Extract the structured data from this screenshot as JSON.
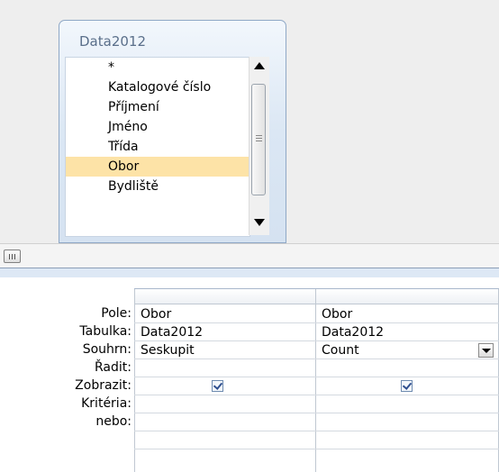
{
  "table": {
    "title": "Data2012",
    "fields": [
      "*",
      "Katalogové číslo",
      "Příjmení",
      "Jméno",
      "Třída",
      "Obor",
      "Bydliště"
    ],
    "selected_field": "Obor"
  },
  "grid": {
    "row_labels": {
      "field": "Pole:",
      "table": "Tabulka:",
      "total": "Souhrn:",
      "sort": "Řadit:",
      "show": "Zobrazit:",
      "criteria": "Kritéria:",
      "or": "nebo:"
    },
    "columns": [
      {
        "field": "Obor",
        "table": "Data2012",
        "total": "Seskupit",
        "sort": "",
        "show": true,
        "criteria": "",
        "or": ""
      },
      {
        "field": "Obor",
        "table": "Data2012",
        "total": "Count",
        "sort": "",
        "show": true,
        "criteria": "",
        "or": ""
      }
    ]
  },
  "colors": {
    "selected_row": "#fde3a7",
    "table_border": "#8fa8c6",
    "title_text": "#5a6f8a"
  },
  "icons": {
    "scroll_up": "triangle-up-icon",
    "scroll_down": "triangle-down-icon",
    "splitter": "grip-icon",
    "dropdown": "chevron-down-icon",
    "checkbox": "checkmark-icon"
  }
}
